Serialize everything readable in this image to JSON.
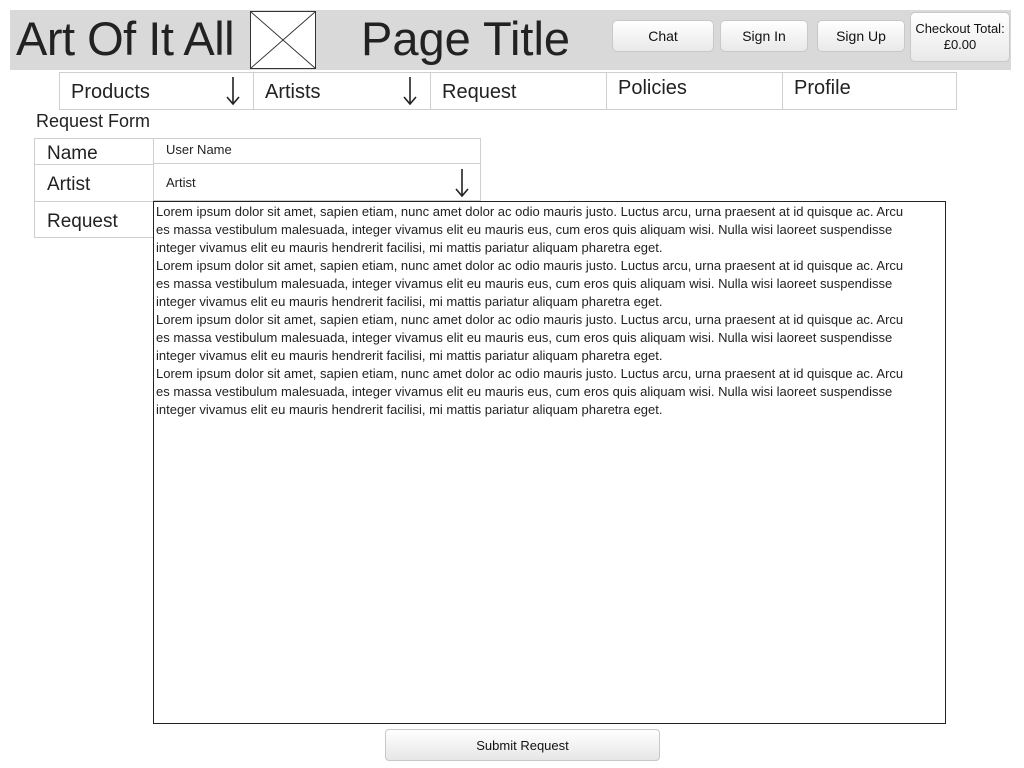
{
  "header": {
    "site_title": "Art Of It All",
    "page_title": "Page Title",
    "chat_label": "Chat",
    "signin_label": "Sign In",
    "signup_label": "Sign Up",
    "checkout_label": "Checkout Total:",
    "checkout_amount": "£0.00"
  },
  "nav": {
    "items": [
      {
        "label": "Products",
        "dropdown": true
      },
      {
        "label": "Artists",
        "dropdown": true
      },
      {
        "label": "Request",
        "dropdown": false
      },
      {
        "label": "Policies",
        "dropdown": false
      },
      {
        "label": "Profile",
        "dropdown": false
      }
    ]
  },
  "form": {
    "heading": "Request Form",
    "name_label": "Name",
    "name_value": "User Name",
    "artist_label": "Artist",
    "artist_value": "Artist",
    "request_label": "Request",
    "request_paragraphs": [
      "Lorem ipsum dolor sit amet, sapien etiam, nunc amet dolor ac odio mauris justo. Luctus arcu, urna praesent at id quisque ac. Arcu es massa vestibulum malesuada, integer vivamus elit eu mauris eus, cum eros quis aliquam wisi. Nulla wisi laoreet suspendisse integer vivamus elit eu mauris hendrerit facilisi, mi mattis pariatur aliquam pharetra eget.",
      "Lorem ipsum dolor sit amet, sapien etiam, nunc amet dolor ac odio mauris justo. Luctus arcu, urna praesent at id quisque ac. Arcu es massa vestibulum malesuada, integer vivamus elit eu mauris eus, cum eros quis aliquam wisi. Nulla wisi laoreet suspendisse integer vivamus elit eu mauris hendrerit facilisi, mi mattis pariatur aliquam pharetra eget.",
      "Lorem ipsum dolor sit amet, sapien etiam, nunc amet dolor ac odio mauris justo. Luctus arcu, urna praesent at id quisque ac. Arcu es massa vestibulum malesuada, integer vivamus elit eu mauris eus, cum eros quis aliquam wisi. Nulla wisi laoreet suspendisse integer vivamus elit eu mauris hendrerit facilisi, mi mattis pariatur aliquam pharetra eget.",
      "Lorem ipsum dolor sit amet, sapien etiam, nunc amet dolor ac odio mauris justo. Luctus arcu, urna praesent at id quisque ac. Arcu es massa vestibulum malesuada, integer vivamus elit eu mauris eus, cum eros quis aliquam wisi. Nulla wisi laoreet suspendisse integer vivamus elit eu mauris hendrerit facilisi, mi mattis pariatur aliquam pharetra eget."
    ],
    "submit_label": "Submit Request"
  },
  "icons": {
    "logo": "image-placeholder-icon",
    "dropdown": "arrow-down-icon"
  },
  "colors": {
    "header_bg": "#d9d9d9",
    "border": "#cfcfcf"
  }
}
